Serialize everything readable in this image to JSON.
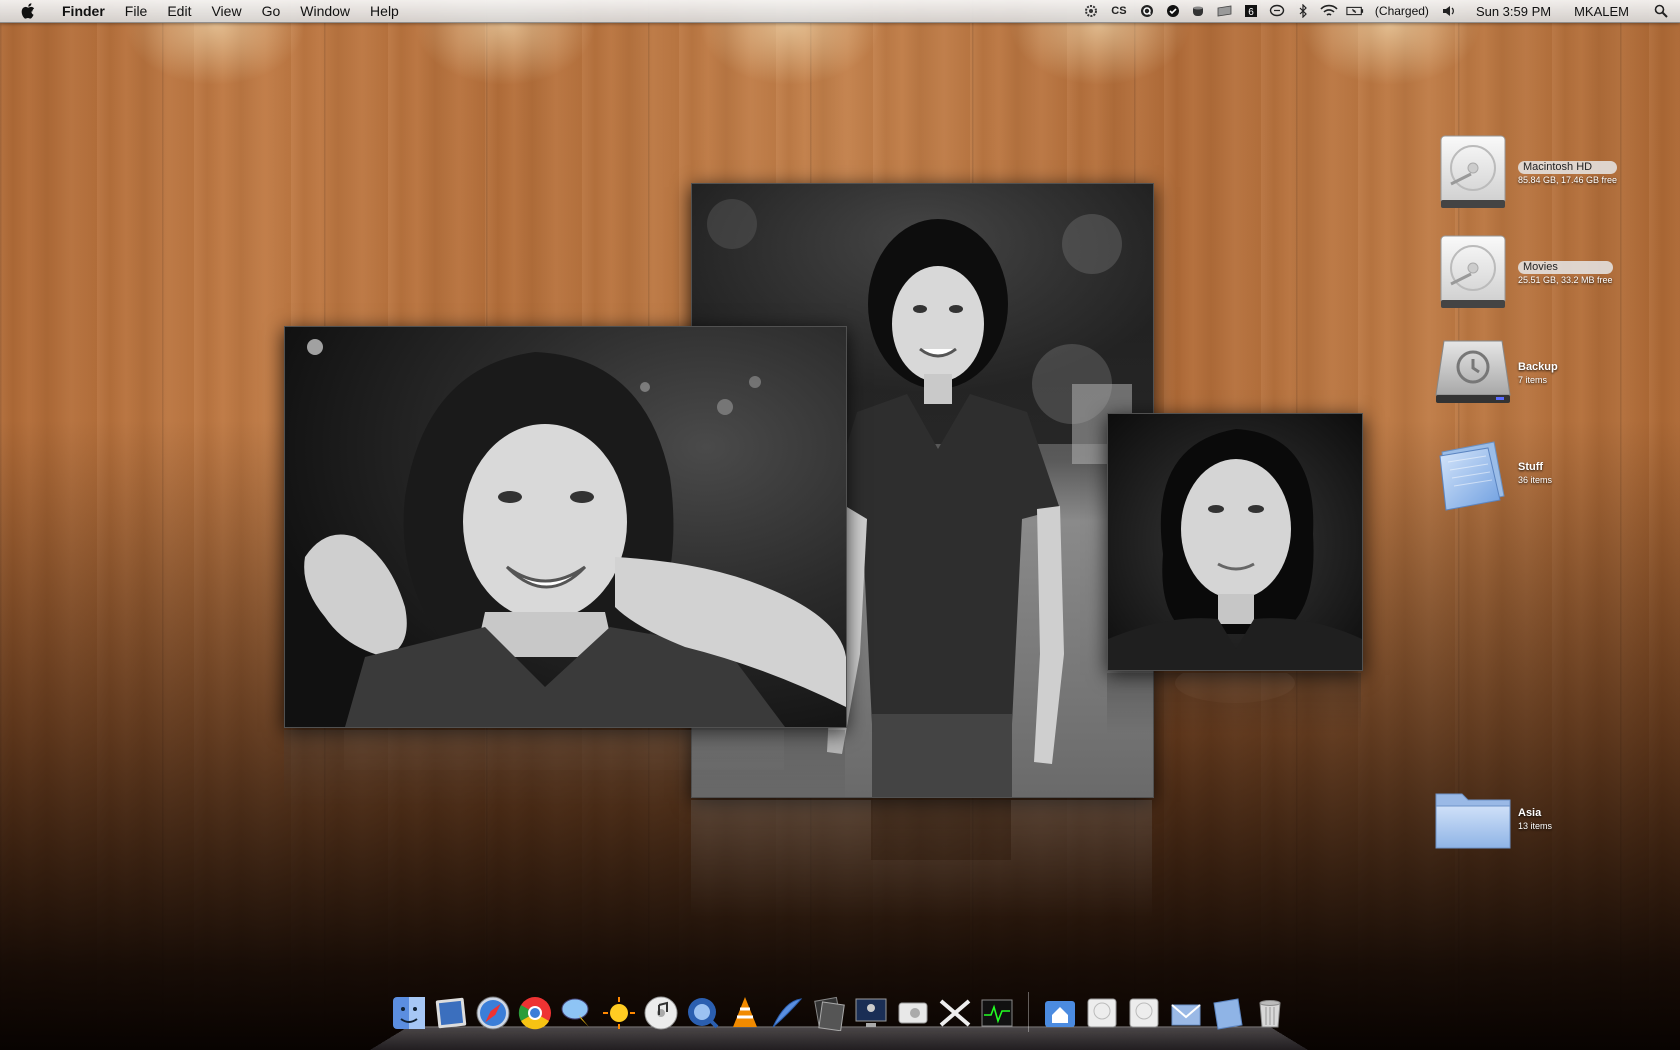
{
  "menubar": {
    "app_name": "Finder",
    "menus": [
      "File",
      "Edit",
      "View",
      "Go",
      "Window",
      "Help"
    ],
    "status": {
      "cs_label": "CS",
      "battery_text": "(Charged)",
      "clock": "Sun 3:59 PM",
      "user": "MKALEM"
    }
  },
  "desktop_icons": [
    {
      "name": "Macintosh HD",
      "info": "85.84 GB, 17.46 GB free",
      "kind": "hard-drive",
      "selected": true
    },
    {
      "name": "Movies",
      "info": "25.51 GB, 33.2 MB free",
      "kind": "hard-drive",
      "selected": true
    },
    {
      "name": "Backup",
      "info": "7 items",
      "kind": "time-machine",
      "selected": false
    },
    {
      "name": "Stuff",
      "info": "36 items",
      "kind": "folder",
      "selected": false
    },
    {
      "name": "Asia",
      "info": "13 items",
      "kind": "folder",
      "selected": false
    }
  ],
  "dock": {
    "apps": [
      "finder-icon",
      "iphoto-icon",
      "safari-icon",
      "chrome-icon",
      "ichat-icon",
      "weather-icon",
      "itunes-icon",
      "quicktime-icon",
      "vlc-icon",
      "quill-icon",
      "photos-icon",
      "desktop-icon",
      "system-profiler-icon",
      "x11-icon",
      "activity-monitor-icon"
    ],
    "stacks": [
      "home-folder-icon",
      "drive-icon",
      "drive-icon",
      "mail-icon",
      "documents-folder-icon",
      "trash-icon"
    ]
  },
  "colors": {
    "wood": "#b8743f",
    "menubar": "#e8e8e8",
    "folder_blue": "#8fb7e8"
  }
}
